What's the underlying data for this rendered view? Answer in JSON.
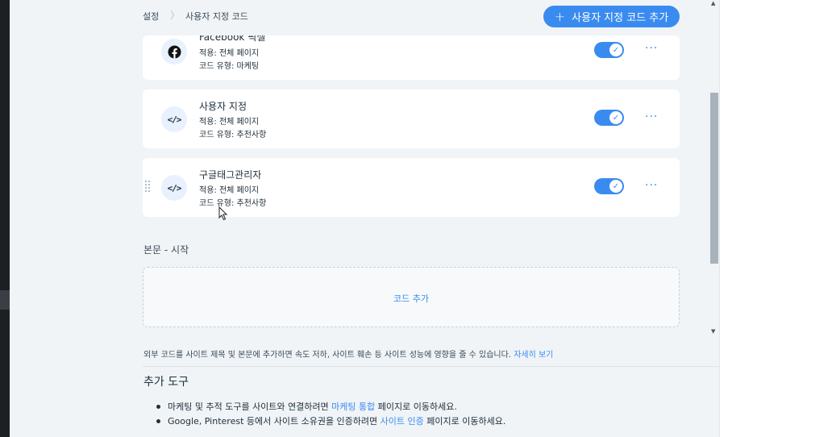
{
  "breadcrumb": {
    "root": "설정",
    "current": "사용자 지정 코드"
  },
  "header": {
    "add_button_label": "사용자 지정 코드 추가"
  },
  "cards": [
    {
      "title": "Facebook 픽셀",
      "meta_apply": "적용: 전체 페이지",
      "meta_type": "코드 유형: 마케팅",
      "icon": "facebook-icon",
      "enabled": true
    },
    {
      "title": "사용자 지정",
      "meta_apply": "적용: 전체 페이지",
      "meta_type": "코드 유형: 추천사항",
      "icon": "code-icon",
      "enabled": true
    },
    {
      "title": "구글태그관리자",
      "meta_apply": "적용: 전체 페이지",
      "meta_type": "코드 유형: 추천사항",
      "icon": "code-icon",
      "enabled": true
    }
  ],
  "section": {
    "label": "본문 - 시작",
    "add_code_label": "코드 추가"
  },
  "notice": {
    "text": "외부 코드를 사이트 제목 및 본문에 추가하면 속도 저하, 사이트 훼손 등 사이트 성능에 영향을 줄 수 있습니다.",
    "link": "자세히 보기"
  },
  "tools": {
    "title": "추가 도구",
    "items": [
      {
        "before": "마케팅 및 추적 도구를 사이트와 연결하려면 ",
        "link": "마케팅 통합",
        "after": " 페이지로 이동하세요."
      },
      {
        "before": "Google, Pinterest 등에서 사이트 소유권을 인증하려면 ",
        "link": "사이트 인증",
        "after": " 페이지로 이동하세요."
      }
    ]
  },
  "colors": {
    "accent": "#3a8bf0",
    "page_bg": "#f0f4f7"
  }
}
